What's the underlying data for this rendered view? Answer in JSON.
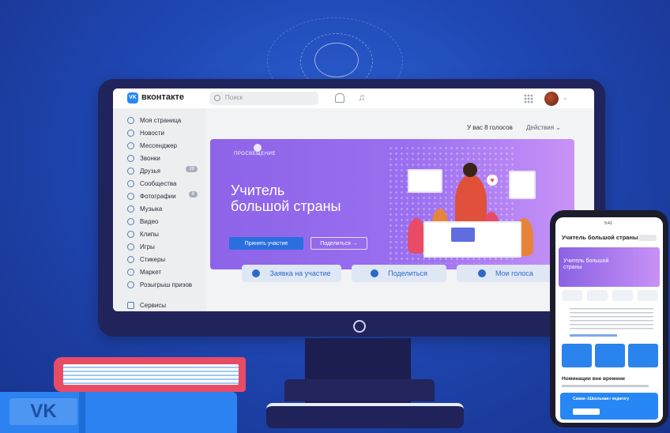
{
  "app": {
    "brand": "вконтакте",
    "logo": "vk"
  },
  "topbar": {
    "search_placeholder": "Поиск"
  },
  "sidebar": {
    "items": [
      {
        "label": "Моя страница",
        "icon": "user-icon"
      },
      {
        "label": "Новости",
        "icon": "news-icon"
      },
      {
        "label": "Мессенджер",
        "icon": "message-icon"
      },
      {
        "label": "Звонки",
        "icon": "phone-icon"
      },
      {
        "label": "Друзья",
        "icon": "friends-icon",
        "badge": "28"
      },
      {
        "label": "Сообщества",
        "icon": "groups-icon"
      },
      {
        "label": "Фотографии",
        "icon": "photo-icon",
        "badge": "4"
      },
      {
        "label": "Музыка",
        "icon": "music-icon"
      },
      {
        "label": "Видео",
        "icon": "video-icon"
      },
      {
        "label": "Клипы",
        "icon": "clips-icon"
      },
      {
        "label": "Игры",
        "icon": "games-icon"
      },
      {
        "label": "Стикеры",
        "icon": "sticker-icon"
      },
      {
        "label": "Маркет",
        "icon": "market-icon"
      },
      {
        "label": "Розыгрыш призов",
        "icon": "prize-icon"
      }
    ],
    "services": "Сервисы"
  },
  "main": {
    "votes_text": "У вас 8 голосов",
    "actions_label": "Действия",
    "banner": {
      "org": "ПРОСВЕЩЕНИЕ",
      "title_line1": "Учитель",
      "title_line2": "большой страны",
      "primary_button": "Принять участие",
      "secondary_button": "Поделиться →"
    },
    "cta": [
      {
        "label": "Заявка на участие",
        "icon": "plus-icon"
      },
      {
        "label": "Поделиться",
        "icon": "share-icon"
      },
      {
        "label": "Мои голоса",
        "icon": "heart-icon"
      }
    ]
  },
  "phone": {
    "status_time": "9:41",
    "title": "Учитель большой страны",
    "banner_title": "Учитель большой страны",
    "nominations": "Номинации вне времени",
    "card_text": "Самая «Школьная» педагогу"
  },
  "colors": {
    "accent": "#2787f5",
    "banner_start": "#8d64e8",
    "banner_end": "#c893f7",
    "background": "#1f47b3"
  }
}
